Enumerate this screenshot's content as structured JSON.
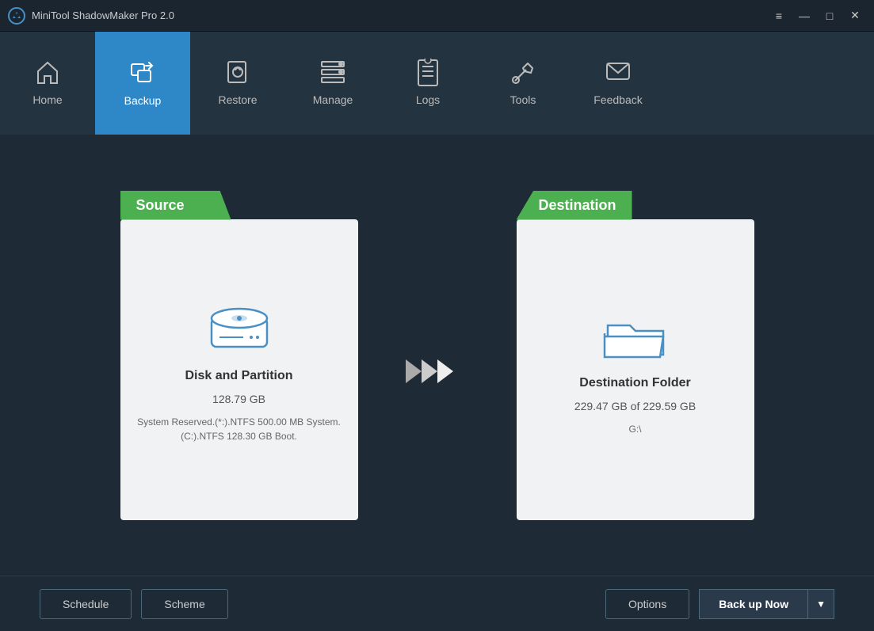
{
  "titleBar": {
    "appName": "MiniTool ShadowMaker Pro 2.0",
    "controls": {
      "menu": "≡",
      "minimize": "—",
      "maximize": "□",
      "close": "✕"
    }
  },
  "nav": {
    "items": [
      {
        "id": "home",
        "label": "Home",
        "active": false
      },
      {
        "id": "backup",
        "label": "Backup",
        "active": true
      },
      {
        "id": "restore",
        "label": "Restore",
        "active": false
      },
      {
        "id": "manage",
        "label": "Manage",
        "active": false
      },
      {
        "id": "logs",
        "label": "Logs",
        "active": false
      },
      {
        "id": "tools",
        "label": "Tools",
        "active": false
      },
      {
        "id": "feedback",
        "label": "Feedback",
        "active": false
      }
    ]
  },
  "source": {
    "label": "Source",
    "title": "Disk and Partition",
    "size": "128.79 GB",
    "description": "System Reserved.(*:).NTFS 500.00 MB System.\n(C:).NTFS 128.30 GB Boot."
  },
  "destination": {
    "label": "Destination",
    "title": "Destination Folder",
    "space": "229.47 GB of 229.59 GB",
    "path": "G:\\"
  },
  "footer": {
    "scheduleLabel": "Schedule",
    "schemeLabel": "Scheme",
    "optionsLabel": "Options",
    "backupLabel": "Back up Now",
    "dropdownArrow": "▼"
  }
}
